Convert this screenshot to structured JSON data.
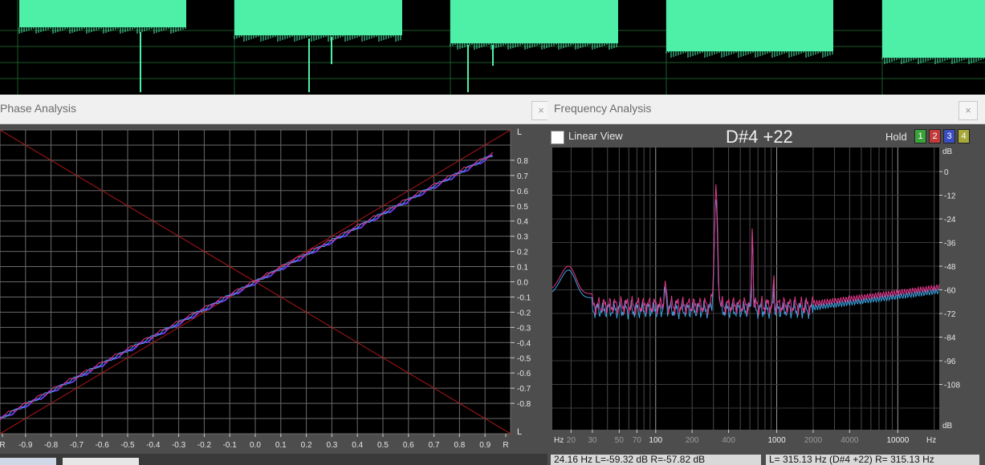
{
  "colors": {
    "waveform": "#4ef0a8",
    "grid": "#6a6a6a",
    "panel_bg": "#4d4d4d",
    "plot_bg": "#000000",
    "trace_left": "#e8368c",
    "trace_right": "#3aa6e6",
    "phase_trace": "#6a3ae8",
    "diagonal": "#b01818",
    "hold1": "#3aa33a",
    "hold2": "#c23a3a",
    "hold3": "#3a4ec2",
    "hold4": "#a8a83a"
  },
  "phase": {
    "title": "Phase Analysis",
    "close_label": "×",
    "right_top_label": "L",
    "right_bottom_label": "L",
    "y_ticks": [
      "0.8",
      "0.7",
      "0.6",
      "0.5",
      "0.4",
      "0.3",
      "0.2",
      "0.1",
      "0.0",
      "-0.1",
      "-0.2",
      "-0.3",
      "-0.4",
      "-0.5",
      "-0.6",
      "-0.7",
      "-0.8"
    ],
    "x_ticks": [
      "R",
      "-0.9",
      "-0.8",
      "-0.7",
      "-0.6",
      "-0.5",
      "-0.4",
      "-0.3",
      "-0.2",
      "-0.1",
      "0.0",
      "0.1",
      "0.2",
      "0.3",
      "0.4",
      "0.5",
      "0.6",
      "0.7",
      "0.8",
      "0.9",
      "R"
    ]
  },
  "frequency": {
    "title": "Frequency Analysis",
    "close_label": "×",
    "linear_view_label": "Linear View",
    "linear_view_checked": false,
    "note_readout": "D#4 +22",
    "hold_label": "Hold",
    "hold_buttons": [
      "1",
      "2",
      "3",
      "4"
    ],
    "db_unit_top": "dB",
    "db_unit_bottom": "dB",
    "db_ticks": [
      "0",
      "-12",
      "-24",
      "-36",
      "-48",
      "-60",
      "-72",
      "-84",
      "-96",
      "-108"
    ],
    "hz_unit_left": "Hz",
    "hz_unit_right": "Hz",
    "hz_ticks": [
      "20",
      "30",
      "50",
      "70",
      "100",
      "200",
      "400",
      "1000",
      "2000",
      "4000",
      "10000"
    ],
    "status_left": "24.16 Hz  L=-59.32 dB  R=-57.82 dB",
    "status_right": "L= 315.13 Hz (D#4 +22)  R= 315.13 Hz"
  }
}
